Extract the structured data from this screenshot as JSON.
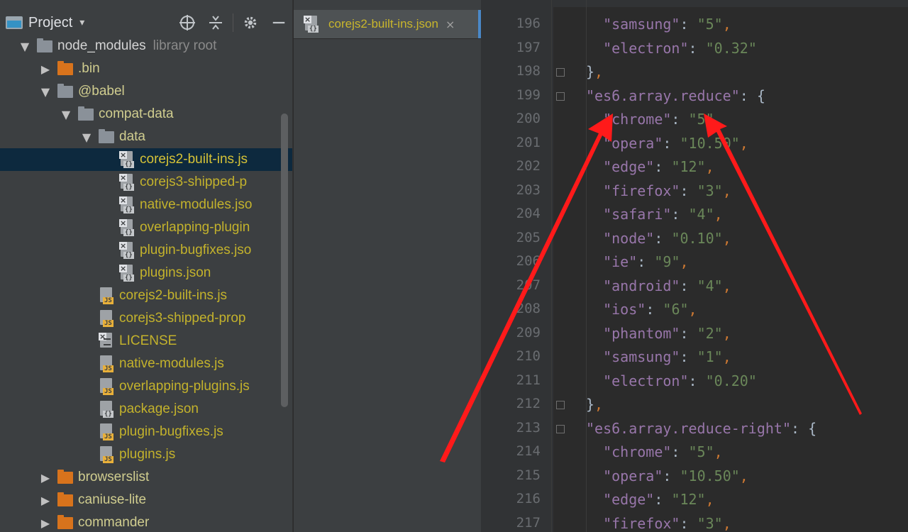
{
  "project_panel": {
    "title": "Project",
    "dropdown": "▾",
    "tools": [
      "crosshair-icon",
      "collapse-icon",
      "gear-icon",
      "minimize-icon"
    ],
    "tree": [
      {
        "label": "node_modules",
        "meta": "library root",
        "type": "folder",
        "color": "gray",
        "indent": 0,
        "arrow": "open",
        "style": "plain"
      },
      {
        "label": ".bin",
        "type": "folder",
        "color": "orange",
        "indent": 1,
        "arrow": "closed",
        "style": "lib"
      },
      {
        "label": "@babel",
        "type": "folder",
        "color": "gray",
        "indent": 1,
        "arrow": "open",
        "style": "lib"
      },
      {
        "label": "compat-data",
        "type": "folder",
        "color": "gray",
        "indent": 2,
        "arrow": "open",
        "style": "lib"
      },
      {
        "label": "data",
        "type": "folder",
        "color": "gray",
        "indent": 3,
        "arrow": "open",
        "style": "lib"
      },
      {
        "label": "corejs2-built-ins.js",
        "type": "json-x",
        "indent": 4,
        "arrow": "none",
        "style": "sel",
        "selected": true
      },
      {
        "label": "corejs3-shipped-p",
        "type": "json-x",
        "indent": 4,
        "arrow": "none",
        "style": "file"
      },
      {
        "label": "native-modules.jso",
        "type": "json-x",
        "indent": 4,
        "arrow": "none",
        "style": "file"
      },
      {
        "label": "overlapping-plugin",
        "type": "json-x",
        "indent": 4,
        "arrow": "none",
        "style": "file"
      },
      {
        "label": "plugin-bugfixes.jso",
        "type": "json-x",
        "indent": 4,
        "arrow": "none",
        "style": "file"
      },
      {
        "label": "plugins.json",
        "type": "json-x",
        "indent": 4,
        "arrow": "none",
        "style": "file"
      },
      {
        "label": "corejs2-built-ins.js",
        "type": "js",
        "indent": 3,
        "arrow": "none",
        "style": "file"
      },
      {
        "label": "corejs3-shipped-prop",
        "type": "js",
        "indent": 3,
        "arrow": "none",
        "style": "file"
      },
      {
        "label": "LICENSE",
        "type": "text-x",
        "indent": 3,
        "arrow": "none",
        "style": "file"
      },
      {
        "label": "native-modules.js",
        "type": "js",
        "indent": 3,
        "arrow": "none",
        "style": "file"
      },
      {
        "label": "overlapping-plugins.js",
        "type": "js",
        "indent": 3,
        "arrow": "none",
        "style": "file"
      },
      {
        "label": "package.json",
        "type": "json",
        "indent": 3,
        "arrow": "none",
        "style": "file"
      },
      {
        "label": "plugin-bugfixes.js",
        "type": "js",
        "indent": 3,
        "arrow": "none",
        "style": "file"
      },
      {
        "label": "plugins.js",
        "type": "js",
        "indent": 3,
        "arrow": "none",
        "style": "file"
      },
      {
        "label": "browserslist",
        "type": "folder",
        "color": "orange",
        "indent": 1,
        "arrow": "closed",
        "style": "lib"
      },
      {
        "label": "caniuse-lite",
        "type": "folder",
        "color": "orange",
        "indent": 1,
        "arrow": "closed",
        "style": "lib"
      },
      {
        "label": "commander",
        "type": "folder",
        "color": "orange",
        "indent": 1,
        "arrow": "closed",
        "style": "lib"
      }
    ]
  },
  "tab": {
    "label": "corejs2-built-ins.json",
    "close": "×",
    "icon": "json-file-icon"
  },
  "editor": {
    "lines": [
      {
        "n": "196",
        "kind": "pair",
        "indent": 2,
        "key": "samsung",
        "val": "5",
        "comma": true
      },
      {
        "n": "197",
        "kind": "pair",
        "indent": 2,
        "key": "electron",
        "val": "0.32",
        "comma": false
      },
      {
        "n": "198",
        "kind": "close",
        "indent": 1,
        "text": "},",
        "fold": true
      },
      {
        "n": "199",
        "kind": "open",
        "indent": 1,
        "key": "es6.array.reduce",
        "fold": true
      },
      {
        "n": "200",
        "kind": "pair",
        "indent": 2,
        "key": "chrome",
        "val": "5",
        "comma": true
      },
      {
        "n": "201",
        "kind": "pair",
        "indent": 2,
        "key": "opera",
        "val": "10.50",
        "comma": true
      },
      {
        "n": "202",
        "kind": "pair",
        "indent": 2,
        "key": "edge",
        "val": "12",
        "comma": true
      },
      {
        "n": "203",
        "kind": "pair",
        "indent": 2,
        "key": "firefox",
        "val": "3",
        "comma": true
      },
      {
        "n": "204",
        "kind": "pair",
        "indent": 2,
        "key": "safari",
        "val": "4",
        "comma": true
      },
      {
        "n": "205",
        "kind": "pair",
        "indent": 2,
        "key": "node",
        "val": "0.10",
        "comma": true
      },
      {
        "n": "206",
        "kind": "pair",
        "indent": 2,
        "key": "ie",
        "val": "9",
        "comma": true
      },
      {
        "n": "207",
        "kind": "pair",
        "indent": 2,
        "key": "android",
        "val": "4",
        "comma": true
      },
      {
        "n": "208",
        "kind": "pair",
        "indent": 2,
        "key": "ios",
        "val": "6",
        "comma": true
      },
      {
        "n": "209",
        "kind": "pair",
        "indent": 2,
        "key": "phantom",
        "val": "2",
        "comma": true
      },
      {
        "n": "210",
        "kind": "pair",
        "indent": 2,
        "key": "samsung",
        "val": "1",
        "comma": true
      },
      {
        "n": "211",
        "kind": "pair",
        "indent": 2,
        "key": "electron",
        "val": "0.20",
        "comma": false
      },
      {
        "n": "212",
        "kind": "close",
        "indent": 1,
        "text": "},",
        "fold": true
      },
      {
        "n": "213",
        "kind": "open",
        "indent": 1,
        "key": "es6.array.reduce-right",
        "fold": true
      },
      {
        "n": "214",
        "kind": "pair",
        "indent": 2,
        "key": "chrome",
        "val": "5",
        "comma": true
      },
      {
        "n": "215",
        "kind": "pair",
        "indent": 2,
        "key": "opera",
        "val": "10.50",
        "comma": true
      },
      {
        "n": "216",
        "kind": "pair",
        "indent": 2,
        "key": "edge",
        "val": "12",
        "comma": true
      },
      {
        "n": "217",
        "kind": "pair",
        "indent": 2,
        "key": "firefox",
        "val": "3",
        "comma": true
      }
    ]
  },
  "colors": {
    "key": "#9876aa",
    "string": "#6a8759",
    "punct": "#cc7832",
    "arrow": "#ff1a1a",
    "selection": "#0d293e",
    "file_label": "#c3b22c"
  }
}
